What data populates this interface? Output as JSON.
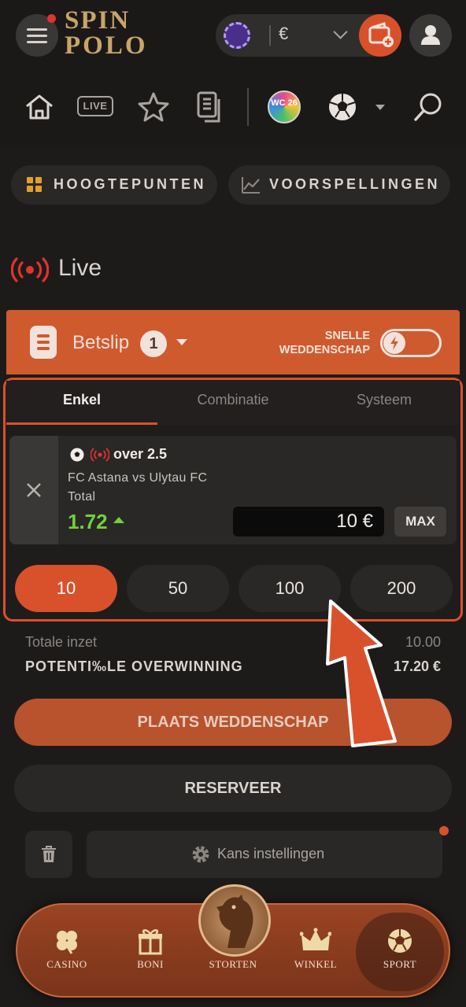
{
  "header": {
    "brand": "SPIN",
    "brand_line2": "POLO",
    "currency": "€",
    "icons": [
      "menu-icon",
      "chip-icon",
      "wallet-plus-icon",
      "user-icon"
    ]
  },
  "nav_icons": [
    "home-icon",
    "live-badge-icon",
    "star-icon",
    "betslip-docs-icon",
    "wc-badge-icon",
    "soccer-ball-icon",
    "search-icon"
  ],
  "nav_live_badge": "LIVE",
  "nav_wc_badge": "WC 26",
  "tabs": {
    "highlights": "HOOGTEPUNTEN",
    "predictions": "VOORSPELLINGEN"
  },
  "live": {
    "title": "Live"
  },
  "betslip": {
    "title": "Betslip",
    "count": "1",
    "quick_bet_line1": "SNELLE",
    "quick_bet_line2": "WEDDENSCHAP",
    "quick_bet_enabled": false,
    "tabs": [
      "Enkel",
      "Combinatie",
      "Systeem"
    ],
    "active_tab": "Enkel",
    "selection": {
      "market": "over 2.5",
      "match": "FC Astana vs Ulytau FC",
      "market_type": "Total",
      "odds": "1.72",
      "odds_trend": "up",
      "stake": "10 €",
      "max_label": "MAX"
    },
    "quick_amounts": [
      "10",
      "50",
      "100",
      "200"
    ],
    "selected_amount": "10",
    "total_stake_label": "Totale inzet",
    "total_stake_value": "10.00",
    "potential_win_label": "POTENTI‰LE OVERWINNING",
    "potential_win_value": "17.20 €",
    "place_bet": "PLAATS WEDDENSCHAP",
    "reserve": "RESERVEER",
    "odds_settings": "Kans instellingen"
  },
  "bottom_nav": [
    {
      "label": "CASINO",
      "icon": "clover-icon"
    },
    {
      "label": "BONI",
      "icon": "gift-icon"
    },
    {
      "label": "STORTEN",
      "icon": "horse-icon"
    },
    {
      "label": "WINKEL",
      "icon": "crown-icon"
    },
    {
      "label": "SPORT",
      "icon": "soccer-ball-icon"
    }
  ],
  "bottom_nav_active": "SPORT",
  "colors": {
    "accent": "#d9512b",
    "odds_up": "#6fd23a",
    "live_red": "#e0342c",
    "background": "#1d1b1a"
  }
}
